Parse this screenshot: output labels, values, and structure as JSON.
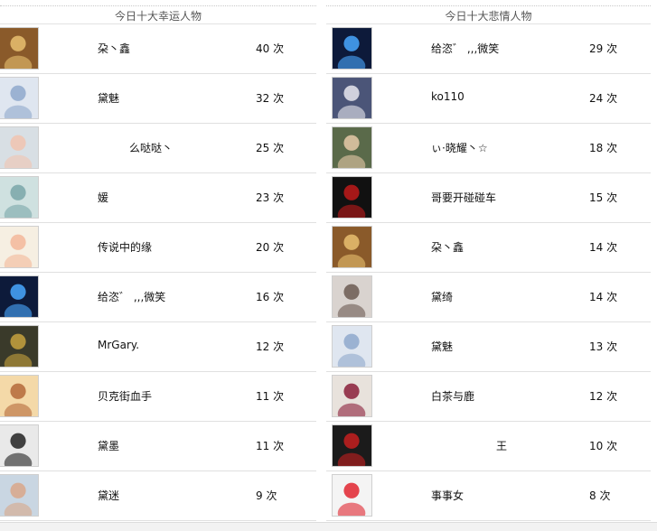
{
  "left": {
    "title": "今日十大幸运人物",
    "rows": [
      {
        "name": "朶丶鑫",
        "count": "40 次",
        "avatar": "golden-portrait-avatar",
        "bg": "#8a5a2a",
        "fg": "#e8c070",
        "indent": 0
      },
      {
        "name": "黛魅",
        "count": "32 次",
        "avatar": "girl-in-blue-avatar",
        "bg": "#dfe6f0",
        "fg": "#8fa8cc",
        "indent": 0
      },
      {
        "name": "么哒哒丶",
        "count": "25 次",
        "avatar": "baby-face-avatar",
        "bg": "#d8dfe4",
        "fg": "#f1c4b0",
        "indent": 1
      },
      {
        "name": "媛",
        "count": "23 次",
        "avatar": "teal-pattern-avatar",
        "bg": "#cfe1e0",
        "fg": "#7aa6a8",
        "indent": 0
      },
      {
        "name": "传说中的缘",
        "count": "20 次",
        "avatar": "cartoon-pig-avatar",
        "bg": "#f6efe2",
        "fg": "#f3b79a",
        "indent": 0
      },
      {
        "name": "给恣゛ ,,,微笑",
        "count": "16 次",
        "avatar": "blue-crystal-avatar",
        "bg": "#0d1a3a",
        "fg": "#49a8ff",
        "indent": 0
      },
      {
        "name": "MrGary.",
        "count": "12 次",
        "avatar": "gary-sign-avatar",
        "bg": "#3a3a2a",
        "fg": "#c7a23e",
        "indent": 0
      },
      {
        "name": "贝克街血手",
        "count": "11 次",
        "avatar": "minion-face-avatar",
        "bg": "#f4d9a8",
        "fg": "#b4693a",
        "indent": 0
      },
      {
        "name": "黛墨",
        "count": "11 次",
        "avatar": "black-dress-avatar",
        "bg": "#e9e9e9",
        "fg": "#222222",
        "indent": 0
      },
      {
        "name": "黛迷",
        "count": "9 次",
        "avatar": "young-man-avatar",
        "bg": "#c9d6e2",
        "fg": "#d9a789",
        "indent": 0
      }
    ]
  },
  "right": {
    "title": "今日十大悲情人物",
    "rows": [
      {
        "name": "给恣゛ ,,,微笑",
        "count": "29 次",
        "avatar": "blue-crystal-avatar",
        "bg": "#0d1a3a",
        "fg": "#49a8ff",
        "indent": 0
      },
      {
        "name": "ko110",
        "count": "24 次",
        "avatar": "anime-detective-avatar",
        "bg": "#4b5578",
        "fg": "#e7e7ef",
        "indent": 0
      },
      {
        "name": "ぃ·晓耀丶☆",
        "count": "18 次",
        "avatar": "anime-boy-avatar",
        "bg": "#5a6a4a",
        "fg": "#e6c9a8",
        "indent": 0
      },
      {
        "name": "哥要开碰碰车",
        "count": "15 次",
        "avatar": "sharingan-eye-avatar",
        "bg": "#111111",
        "fg": "#c01a1a",
        "indent": 0
      },
      {
        "name": "朶丶鑫",
        "count": "14 次",
        "avatar": "golden-portrait-avatar",
        "bg": "#8a5a2a",
        "fg": "#e8c070",
        "indent": 0
      },
      {
        "name": "黛绮",
        "count": "14 次",
        "avatar": "girl-portrait-avatar",
        "bg": "#d9d3cf",
        "fg": "#6b5a52",
        "indent": 0
      },
      {
        "name": "黛魅",
        "count": "13 次",
        "avatar": "girl-in-blue-avatar",
        "bg": "#dfe6f0",
        "fg": "#8fa8cc",
        "indent": 0
      },
      {
        "name": "白茶与鹿",
        "count": "12 次",
        "avatar": "girl-red-hat-avatar",
        "bg": "#e8e2dc",
        "fg": "#8a1f3a",
        "indent": 0
      },
      {
        "name": "王",
        "count": "10 次",
        "avatar": "red-black-anime-avatar",
        "bg": "#1b1b1b",
        "fg": "#c41f1f",
        "indent": 2
      },
      {
        "name": "事事女",
        "count": "8 次",
        "avatar": "handcuffs-heart-avatar",
        "bg": "#f4f4f4",
        "fg": "#e0252f",
        "indent": 0
      }
    ]
  }
}
